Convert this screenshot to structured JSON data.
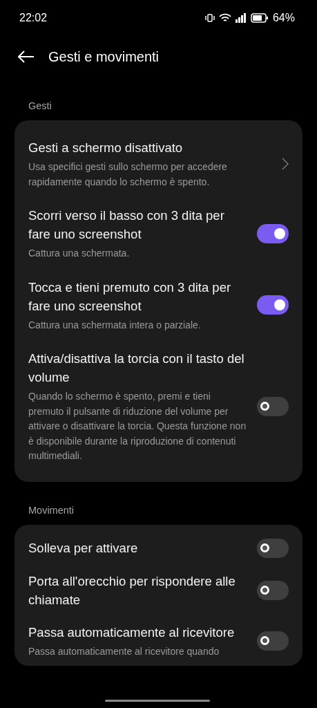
{
  "status_bar": {
    "time": "22:02",
    "battery": "64%"
  },
  "header": {
    "title": "Gesti e movimenti"
  },
  "sections": [
    {
      "label": "Gesti",
      "items": [
        {
          "kind": "link",
          "title": "Gesti a schermo disattivato",
          "subtitle": "Usa specifici gesti sullo schermo per accedere rapidamente quando lo schermo è spento."
        },
        {
          "kind": "toggle",
          "title": "Scorri verso il basso con 3 dita per fare uno screenshot",
          "subtitle": "Cattura una schermata.",
          "on": true
        },
        {
          "kind": "toggle",
          "title": "Tocca e tieni premuto con 3 dita per fare uno screenshot",
          "subtitle": "Cattura una schermata intera o parziale.",
          "on": true
        },
        {
          "kind": "toggle",
          "title": "Attiva/disattiva la torcia con il tasto del volume",
          "subtitle": "Quando lo schermo è spento, premi e tieni premuto il pulsante di riduzione del volume per attivare o disattivare la torcia. Questa funzione non è disponibile durante la riproduzione di contenuti multimediali.",
          "on": false
        }
      ]
    },
    {
      "label": "Movimenti",
      "items": [
        {
          "kind": "toggle",
          "title": "Solleva per attivare",
          "on": false
        },
        {
          "kind": "toggle",
          "title": "Porta all'orecchio per rispondere alle chiamate",
          "on": false
        },
        {
          "kind": "toggle",
          "title": "Passa automaticamente al ricevitore",
          "subtitle": "Passa automaticamente al ricevitore quando",
          "on": false
        }
      ]
    }
  ]
}
